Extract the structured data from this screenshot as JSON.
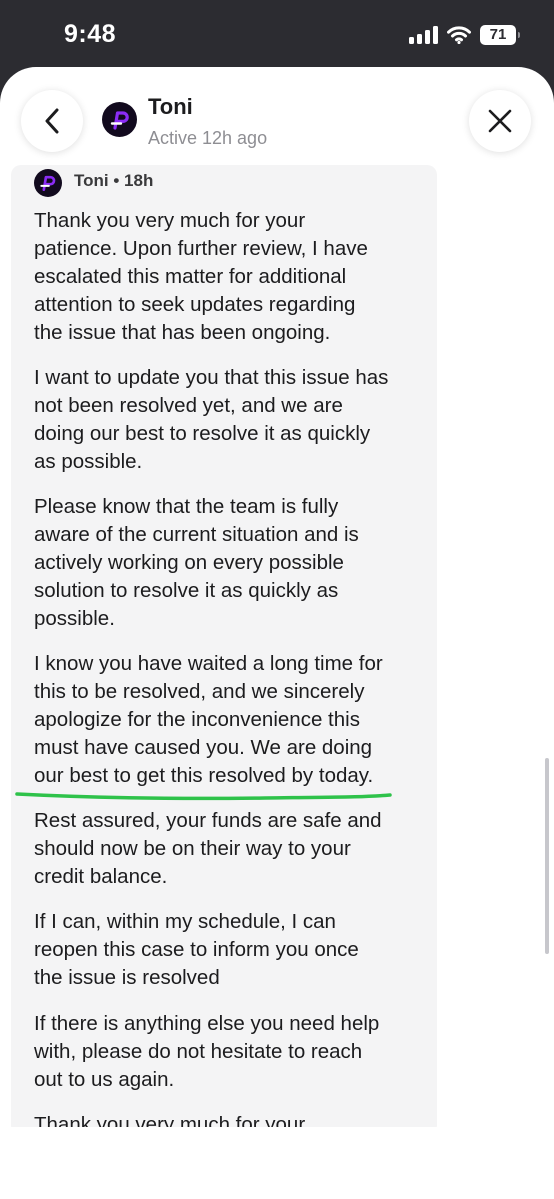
{
  "status_bar": {
    "time": "9:48",
    "battery": "71"
  },
  "header": {
    "name": "Toni",
    "status": "Active 12h ago"
  },
  "icons": {
    "back": "chevron-left-icon",
    "close": "close-icon",
    "scroll_down": "chevron-down-icon",
    "signal": "cellular-signal-icon",
    "wifi": "wifi-icon",
    "battery": "battery-icon"
  },
  "colors": {
    "brand_purple": "#8b2cf5",
    "status_bar": "#2c2c31",
    "card": "#f4f4f5",
    "annotation_green": "#2ec24a"
  },
  "message": {
    "author": "Toni",
    "time": "18h",
    "paragraphs": [
      "Thank you very much for your\npatience. Upon further review, I have\nescalated this matter for additional\nattention to seek updates regarding\nthe issue that has been ongoing.",
      "I want to update you that this issue has\nnot been resolved yet, and we are\ndoing our best to resolve it as quickly\nas possible.",
      "Please know that the team is fully\naware of the current situation and is\nactively working on every possible\nsolution to resolve it as quickly as\npossible.",
      "I know you have waited a long time for\nthis to be resolved, and we sincerely\napologize for the inconvenience this\nmust have caused you. We are doing\nour best to get this resolved by today.",
      "Rest assured, your funds are safe and\nshould now be on their way to your\ncredit balance.",
      "If I can, within my schedule, I can\nreopen this case to inform you once\nthe issue is resolved",
      "If there is anything else you need help\nwith, please do not hesitate to reach\nout to us again.",
      "Thank you very much for your"
    ]
  }
}
